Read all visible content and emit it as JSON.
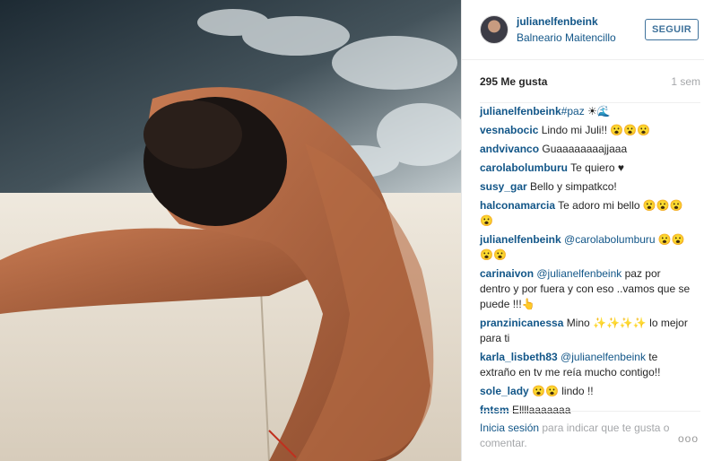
{
  "header": {
    "username": "julianelfenbeink",
    "location": "Balneario Maitencillo",
    "follow_label": "SEGUIR"
  },
  "stats": {
    "likes": "295 Me gusta",
    "time": "1 sem"
  },
  "comments": [
    {
      "user": "julianelfenbeink",
      "parts": [
        {
          "type": "tag",
          "text": "#paz"
        },
        {
          "type": "text",
          "text": " ☀🌊"
        }
      ]
    },
    {
      "user": "vesnabocic",
      "parts": [
        {
          "type": "text",
          "text": " Lindo mi Juli!! 😮😮😮"
        }
      ]
    },
    {
      "user": "andvivanco",
      "parts": [
        {
          "type": "text",
          "text": " Guaaaaaaaajjaaa"
        }
      ]
    },
    {
      "user": "carolabolumburu",
      "parts": [
        {
          "type": "text",
          "text": " Te quiero ♥"
        }
      ]
    },
    {
      "user": "susy_gar",
      "parts": [
        {
          "type": "text",
          "text": " Bello y simpatkco!"
        }
      ]
    },
    {
      "user": "halconamarcia",
      "parts": [
        {
          "type": "text",
          "text": " Te adoro mi bello 😮😮😮😮"
        }
      ]
    },
    {
      "user": "julianelfenbeink",
      "parts": [
        {
          "type": "mention",
          "text": " @carolabolumburu"
        },
        {
          "type": "text",
          "text": " 😮😮😮😮"
        }
      ]
    },
    {
      "user": "carinaivon",
      "parts": [
        {
          "type": "mention",
          "text": " @julianelfenbeink"
        },
        {
          "type": "text",
          "text": " paz por dentro y por fuera y con eso ..vamos que se puede !!!👆"
        }
      ]
    },
    {
      "user": "pranzinicanessa",
      "parts": [
        {
          "type": "text",
          "text": " Mino ✨✨✨✨ lo mejor para ti"
        }
      ]
    },
    {
      "user": "karla_lisbeth83",
      "parts": [
        {
          "type": "mention",
          "text": " @julianelfenbeink"
        },
        {
          "type": "text",
          "text": " te extraño en tv me reía mucho contigo!!"
        }
      ]
    },
    {
      "user": "sole_lady",
      "parts": [
        {
          "type": "text",
          "text": " 😮😮 lindo !!"
        }
      ]
    },
    {
      "user": "fntsm",
      "parts": [
        {
          "type": "text",
          "text": " Ellllaaaaaaa"
        }
      ]
    }
  ],
  "footer": {
    "login_label": "Inicia sesión",
    "rest": " para indicar que te gusta o comentar.",
    "more_icon": "ooo"
  }
}
